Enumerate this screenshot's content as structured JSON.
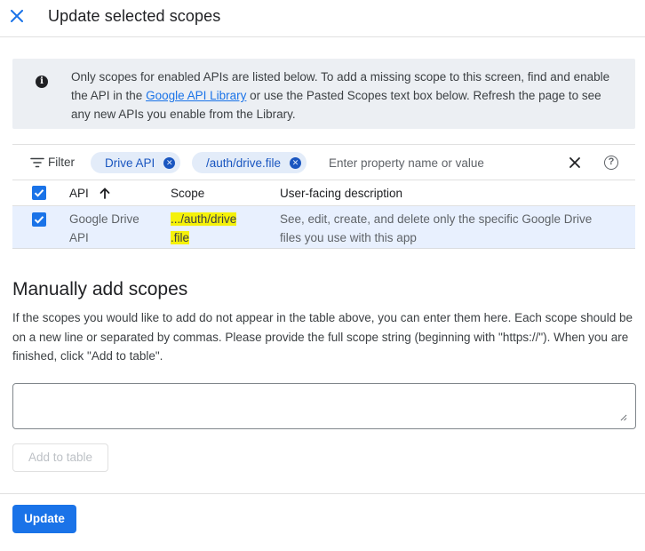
{
  "header": {
    "title": "Update selected scopes",
    "close_icon": "close-icon"
  },
  "banner": {
    "icon": "info-icon",
    "text_before": "Only scopes for enabled APIs are listed below. To add a missing scope to this screen, find and enable the API in the ",
    "link": "Google API Library",
    "text_after": " or use the Pasted Scopes text box below. Refresh the page to see any new APIs you enable from the Library."
  },
  "filter": {
    "label": "Filter",
    "chips": [
      {
        "label": "Drive API"
      },
      {
        "label": "/auth/drive.file"
      }
    ],
    "placeholder": "Enter property name or value",
    "help": "?"
  },
  "table": {
    "headers": {
      "api": "API",
      "scope": "Scope",
      "description": "User-facing description"
    },
    "rows": [
      {
        "api_line1": "Google Drive",
        "api_line2": "API",
        "scope_line1": ".../auth/drive",
        "scope_line2": ".file",
        "desc_line1": "See, edit, create, and delete only the specific Google Drive",
        "desc_line2": "files you use with this app",
        "checked": true
      }
    ]
  },
  "manual": {
    "title": "Manually add scopes",
    "description": "If the scopes you would like to add do not appear in the table above, you can enter them here. Each scope should be on a new line or separated by commas. Please provide the full scope string (beginning with \"https://\"). When you are finished, click \"Add to table\".",
    "textarea_value": "",
    "add_button": "Add to table"
  },
  "footer": {
    "update_button": "Update"
  },
  "colors": {
    "accent": "#1a73e8",
    "chip_bg": "#e3ecf9",
    "highlight": "#f5f10a",
    "banner_bg": "#eceff3"
  }
}
